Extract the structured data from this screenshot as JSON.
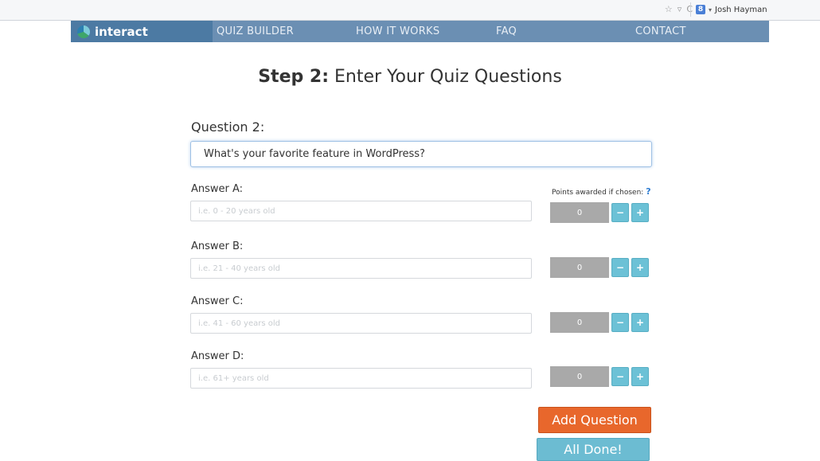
{
  "browser": {
    "user_name": "Josh Hayman",
    "profile_icon": "google-plus-icon",
    "star_icon": "bookmark-star-icon",
    "reload_icon": "reload-icon"
  },
  "nav": {
    "logo_text": "interact",
    "items": [
      "QUIZ BUILDER",
      "HOW IT WORKS",
      "FAQ",
      "CONTACT"
    ],
    "colors": {
      "bar": "#6b8fb3",
      "logo_bg": "#4c7aa3"
    }
  },
  "page": {
    "step_prefix": "Step 2:",
    "step_title": "Enter Your Quiz Questions"
  },
  "question": {
    "label": "Question 2:",
    "value": "What's your favorite feature in WordPress?"
  },
  "points": {
    "label": "Points awarded if chosen:",
    "help": "?"
  },
  "answers": [
    {
      "label": "Answer A:",
      "placeholder": "i.e. 0 - 20 years old",
      "points": "0",
      "minus": "−",
      "plus": "+"
    },
    {
      "label": "Answer B:",
      "placeholder": "i.e. 21 - 40 years old",
      "points": "0",
      "minus": "−",
      "plus": "+"
    },
    {
      "label": "Answer C:",
      "placeholder": "i.e. 41 - 60 years old",
      "points": "0",
      "minus": "−",
      "plus": "+"
    },
    {
      "label": "Answer D:",
      "placeholder": "i.e. 61+ years old",
      "points": "0",
      "minus": "−",
      "plus": "+"
    }
  ],
  "buttons": {
    "add_question": "Add Question",
    "all_done": "All Done!",
    "colors": {
      "add": "#e8672c",
      "done": "#6cbcd2",
      "stepper": "#6cc1d6"
    }
  }
}
